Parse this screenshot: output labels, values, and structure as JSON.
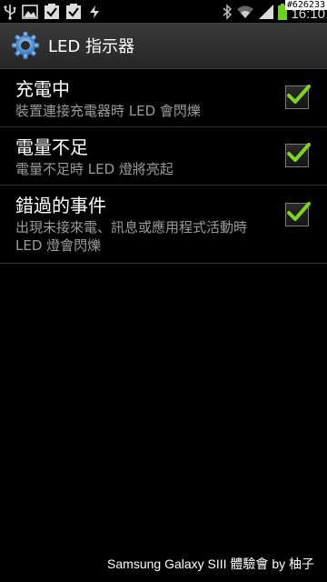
{
  "status_bar": {
    "time": "16:10",
    "overlay_code": "#626233",
    "icons": [
      "usb-icon",
      "image-icon",
      "checklist-icon",
      "checklist-icon",
      "sync-icon",
      "bluetooth-icon",
      "wifi-icon",
      "signal-icon",
      "battery-icon"
    ]
  },
  "title_bar": {
    "title": "LED 指示器",
    "icon": "settings-gear-icon"
  },
  "preferences": [
    {
      "title": "充電中",
      "summary": "裝置連接充電器時 LED 會閃爍",
      "checked": true
    },
    {
      "title": "電量不足",
      "summary": "電量不足時 LED 燈將亮起",
      "checked": true
    },
    {
      "title": "錯過的事件",
      "summary": "出現未接來電、訊息或應用程式活動時 LED 燈會閃爍",
      "checked": true
    }
  ],
  "footer": {
    "credit": "Samsung Galaxy SIII 體驗會 by 柚子"
  },
  "colors": {
    "accent_check": "#7fd321",
    "summary_text": "#9a9a9a",
    "battery": "#6fd11d"
  }
}
